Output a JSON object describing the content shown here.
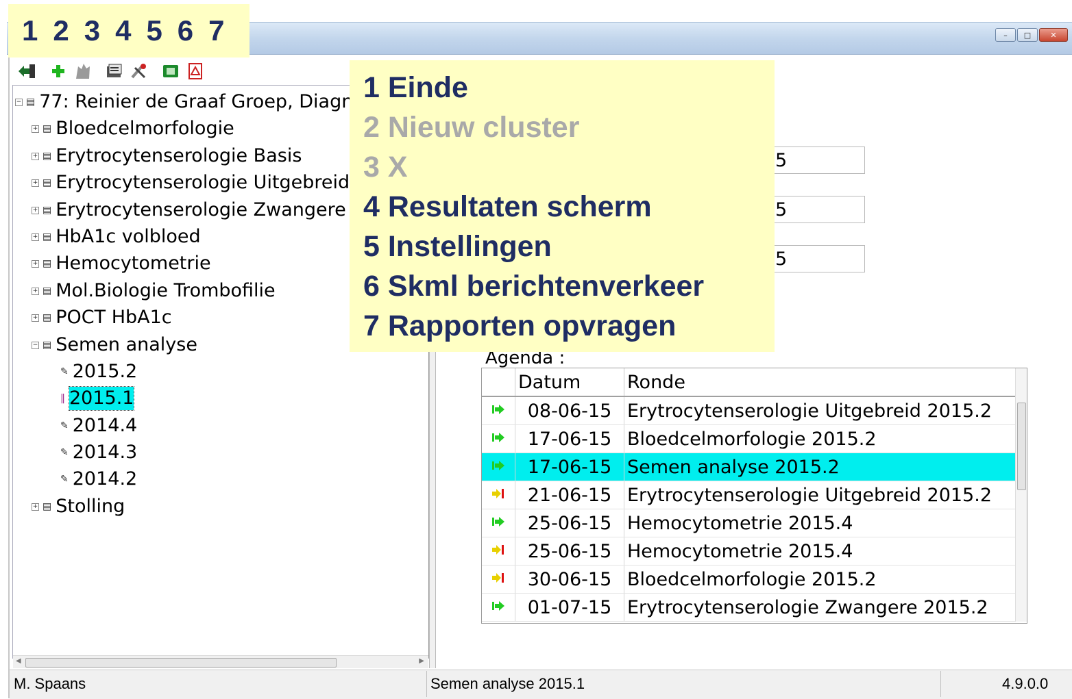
{
  "legend_numbers": [
    "1",
    "2",
    "3",
    "4",
    "5",
    "6",
    "7"
  ],
  "legend_items": [
    {
      "text": "1 Einde",
      "dim": false
    },
    {
      "text": "2 Nieuw cluster",
      "dim": true
    },
    {
      "text": "3 X",
      "dim": true
    },
    {
      "text": "4 Resultaten scherm",
      "dim": false
    },
    {
      "text": "5 Instellingen",
      "dim": false
    },
    {
      "text": "6 Skml berichtenverkeer",
      "dim": false
    },
    {
      "text": "7 Rapporten opvragen",
      "dim": false
    }
  ],
  "toolbar_icons": [
    "exit-icon",
    "new-cluster-icon",
    "delete-icon",
    "results-screen-icon",
    "settings-icon",
    "skml-messaging-icon",
    "reports-icon"
  ],
  "tree": {
    "root": "77: Reinier de Graaf Groep, Diagn",
    "items": [
      {
        "label": "Bloedcelmorfologie"
      },
      {
        "label": "Erytrocytenserologie Basis"
      },
      {
        "label": "Erytrocytenserologie Uitgebreid"
      },
      {
        "label": "Erytrocytenserologie Zwangere"
      },
      {
        "label": "HbA1c volbloed"
      },
      {
        "label": "Hemocytometrie"
      },
      {
        "label": "Mol.Biologie Trombofilie"
      },
      {
        "label": "POCT HbA1c"
      },
      {
        "label": "Semen analyse"
      },
      {
        "label": "Stolling"
      }
    ],
    "semen_children": [
      "2015.2",
      "2015.1",
      "2014.4",
      "2014.3",
      "2014.2"
    ],
    "selected": "2015.1"
  },
  "right_fields": [
    "5",
    "5",
    "5"
  ],
  "agenda": {
    "label": "Agenda :",
    "columns": [
      "",
      "Datum",
      "Ronde"
    ],
    "rows": [
      {
        "status": "go",
        "datum": "08-06-15",
        "ronde": "Erytrocytenserologie Uitgebreid 2015.2"
      },
      {
        "status": "go",
        "datum": "17-06-15",
        "ronde": "Bloedcelmorfologie 2015.2"
      },
      {
        "status": "go",
        "datum": "17-06-15",
        "ronde": "Semen analyse 2015.2",
        "selected": true
      },
      {
        "status": "warn",
        "datum": "21-06-15",
        "ronde": "Erytrocytenserologie Uitgebreid 2015.2"
      },
      {
        "status": "go",
        "datum": "25-06-15",
        "ronde": "Hemocytometrie 2015.4"
      },
      {
        "status": "warn",
        "datum": "25-06-15",
        "ronde": "Hemocytometrie 2015.4"
      },
      {
        "status": "warn",
        "datum": "30-06-15",
        "ronde": "Bloedcelmorfologie 2015.2"
      },
      {
        "status": "go",
        "datum": "01-07-15",
        "ronde": "Erytrocytenserologie Zwangere 2015.2"
      }
    ]
  },
  "status_bar": {
    "user": "M. Spaans",
    "context": "Semen analyse 2015.1",
    "version": "4.9.0.0"
  },
  "colors": {
    "legend_bg": "#ffffc4",
    "legend_text": "#1f2d63",
    "selection": "#00eeee"
  }
}
